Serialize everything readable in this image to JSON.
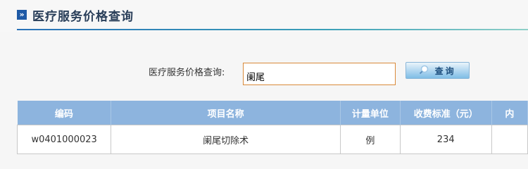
{
  "header": {
    "icon": "double-chevron-right-icon",
    "title": "医疗服务价格查询"
  },
  "search": {
    "label": "医疗服务价格查询:",
    "value": "阑尾",
    "button_label": "查询",
    "button_icon": "magnifier-icon"
  },
  "table": {
    "columns": [
      "编码",
      "项目名称",
      "计量单位",
      "收费标准（元）",
      "内"
    ],
    "rows": [
      [
        "w0401000023",
        "阑尾切除术",
        "例",
        "234",
        ""
      ]
    ]
  },
  "colors": {
    "header_icon": "#1f5aa6",
    "table_header_bg": "#8db4de",
    "input_border": "#d98a3a"
  }
}
